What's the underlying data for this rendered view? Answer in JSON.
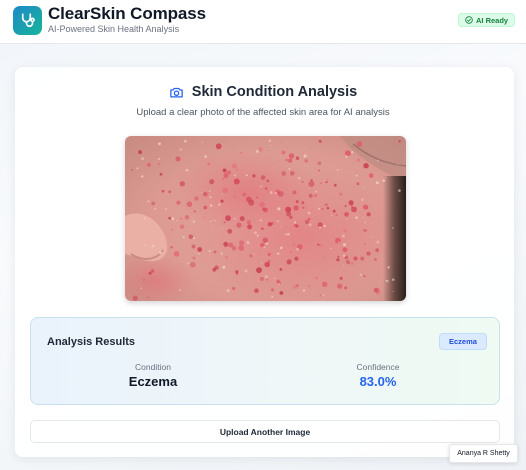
{
  "header": {
    "app_title": "ClearSkin Compass",
    "app_subtitle": "AI-Powered Skin Health Analysis",
    "logo_icon": "stethoscope-icon",
    "status_badge": "AI Ready",
    "status_icon": "check-circle-icon"
  },
  "analysis": {
    "title": "Skin Condition Analysis",
    "title_icon": "camera-icon",
    "instructions": "Upload a clear photo of the affected skin area for AI analysis"
  },
  "results": {
    "heading": "Analysis Results",
    "badge": "Eczema",
    "condition_label": "Condition",
    "condition_value": "Eczema",
    "confidence_label": "Confidence",
    "confidence_value": "83.0%"
  },
  "actions": {
    "upload_another_label": "Upload Another Image"
  },
  "user": {
    "name": "Ananya R Shetty"
  },
  "colors": {
    "brand_gradient_start": "#1e88c7",
    "brand_gradient_end": "#17b59a",
    "confidence_accent": "#2563eb",
    "ready_green": "#15803d"
  }
}
